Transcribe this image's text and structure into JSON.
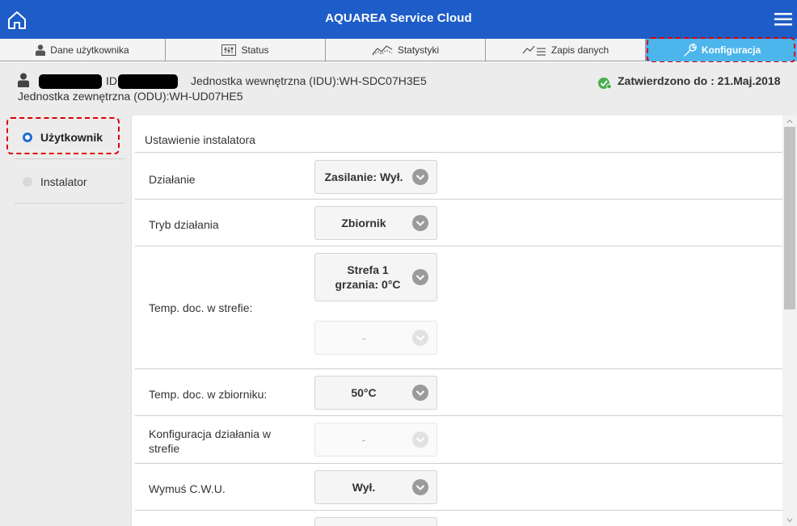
{
  "app": {
    "title": "AQUAREA Service Cloud"
  },
  "tabs": [
    {
      "label": "Dane użytkownika",
      "icon": "user-icon"
    },
    {
      "label": "Status",
      "icon": "status-icon"
    },
    {
      "label": "Statystyki",
      "icon": "chart-icon"
    },
    {
      "label": "Zapis danych",
      "icon": "data-log-icon"
    },
    {
      "label": "Konfiguracja",
      "icon": "wrench-icon",
      "active": true
    }
  ],
  "info": {
    "id_label": "ID",
    "idu": "Jednostka wewnętrzna (IDU):WH-SDC07H3E5",
    "odu": "Jednostka zewnętrzna (ODU):WH-UD07HE5",
    "approved": "Zatwierdzono do : 21.Maj.2018"
  },
  "leftnav": [
    {
      "label": "Użytkownik",
      "selected": true
    },
    {
      "label": "Instalator",
      "selected": false
    }
  ],
  "main": {
    "section_title": "Ustawienie instalatora",
    "rows": [
      {
        "label": "Działanie",
        "value": "Zasilanie: Wył."
      },
      {
        "label": "Tryb działania",
        "value": "Zbiornik"
      },
      {
        "label": "Temp. doc. w strefie:",
        "value": "Strefa 1 grzania: 0°C",
        "value2": "-"
      },
      {
        "label": "Temp. doc. w zbiorniku:",
        "value": "50°C"
      },
      {
        "label": "Konfiguracja działania w strefie",
        "value": "-"
      },
      {
        "label": "Wymuś C.W.U.",
        "value": "Wył."
      }
    ]
  },
  "colors": {
    "topbar": "#1e5cc8",
    "active_tab": "#4cb5ec",
    "approved": "#4caf50",
    "highlight": "#e00000"
  }
}
